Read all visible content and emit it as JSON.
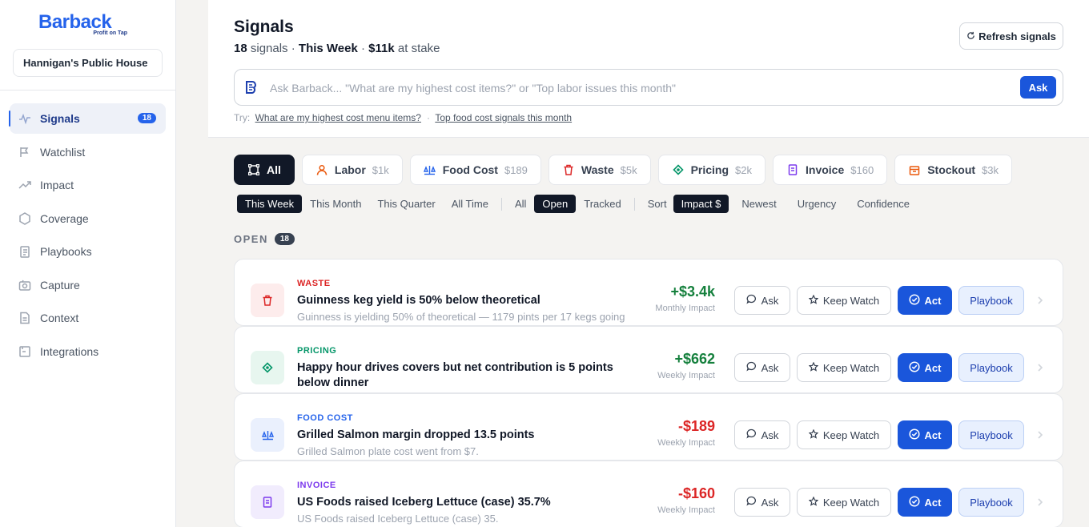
{
  "sidebar": {
    "logo": {
      "word": "Barback",
      "tagline": "Profit on Tap"
    },
    "venue": "Hannigan's Public House",
    "items": [
      {
        "label": "Signals",
        "badge": "18",
        "icon": "signals-icon",
        "active": true
      },
      {
        "label": "Watchlist",
        "icon": "flag-icon"
      },
      {
        "label": "Impact",
        "icon": "trend-icon"
      },
      {
        "label": "Coverage",
        "icon": "hexagon-icon"
      },
      {
        "label": "Playbooks",
        "icon": "playbook-icon"
      },
      {
        "label": "Capture",
        "icon": "camera-icon"
      },
      {
        "label": "Context",
        "icon": "document-icon"
      },
      {
        "label": "Integrations",
        "icon": "integrations-icon"
      }
    ]
  },
  "header": {
    "title": "Signals",
    "count": "18",
    "count_word": "signals",
    "period": "This Week",
    "at_stake": "$11k",
    "at_stake_label": "at stake",
    "refresh_label": "Refresh signals"
  },
  "ask": {
    "placeholder": "Ask Barback... \"What are my highest cost items?\" or \"Top labor issues this month\"",
    "button": "Ask",
    "try_label": "Try:",
    "suggestions": [
      "What are my highest cost menu items?",
      "Top food cost signals this month"
    ]
  },
  "categories": [
    {
      "label": "All",
      "amount": "",
      "icon": "all-icon",
      "active": true
    },
    {
      "label": "Labor",
      "amount": "$1k",
      "icon": "person-icon",
      "color": "#ea580c"
    },
    {
      "label": "Food Cost",
      "amount": "$189",
      "icon": "scale-icon",
      "color": "#2563eb"
    },
    {
      "label": "Waste",
      "amount": "$5k",
      "icon": "trash-icon",
      "color": "#dc2626"
    },
    {
      "label": "Pricing",
      "amount": "$2k",
      "icon": "tag-icon",
      "color": "#059669"
    },
    {
      "label": "Invoice",
      "amount": "$160",
      "icon": "invoice-icon",
      "color": "#7c3aed"
    },
    {
      "label": "Stockout",
      "amount": "$3k",
      "icon": "box-icon",
      "color": "#ea580c"
    }
  ],
  "filters": {
    "periods": [
      "This Week",
      "This Month",
      "This Quarter",
      "All Time"
    ],
    "active_period": "This Week",
    "statuses": [
      "All",
      "Open",
      "Tracked"
    ],
    "active_status": "Open",
    "sort_label": "Sort",
    "sorts": [
      "Impact $",
      "Newest",
      "Urgency",
      "Confidence"
    ],
    "active_sort": "Impact $"
  },
  "section": {
    "label": "OPEN",
    "count": "18"
  },
  "actions": {
    "ask": "Ask",
    "watch": "Keep Watch",
    "act": "Act",
    "playbook": "Playbook"
  },
  "signals": [
    {
      "category": "WASTE",
      "cat_color": "#dc2626",
      "icon": "trash-icon",
      "icon_bg": "#fdecec",
      "title": "Guinness keg yield is 50% below theoretical",
      "description": "Guinness is yielding 50% of theoretical — 1179 pints per 17 kegs going",
      "amount": "+$3.4k",
      "amount_color": "#15803d",
      "amount_label": "Monthly Impact"
    },
    {
      "category": "PRICING",
      "cat_color": "#059669",
      "icon": "tag-icon",
      "icon_bg": "#e7f6ef",
      "title": "Happy hour drives covers but net contribution is 5 points below dinner",
      "description": "",
      "amount": "+$662",
      "amount_color": "#15803d",
      "amount_label": "Weekly Impact"
    },
    {
      "category": "FOOD COST",
      "cat_color": "#2563eb",
      "icon": "scale-icon",
      "icon_bg": "#eaf0fd",
      "title": "Grilled Salmon margin dropped 13.5 points",
      "description": "Grilled Salmon plate cost went from $7.",
      "amount": "-$189",
      "amount_color": "#dc2626",
      "amount_label": "Weekly Impact"
    },
    {
      "category": "INVOICE",
      "cat_color": "#7c3aed",
      "icon": "invoice-icon",
      "icon_bg": "#f1ecfd",
      "title": "US Foods raised Iceberg Lettuce (case) 35.7%",
      "description": "US Foods raised Iceberg Lettuce (case) 35.",
      "amount": "-$160",
      "amount_color": "#dc2626",
      "amount_label": "Weekly Impact"
    }
  ]
}
